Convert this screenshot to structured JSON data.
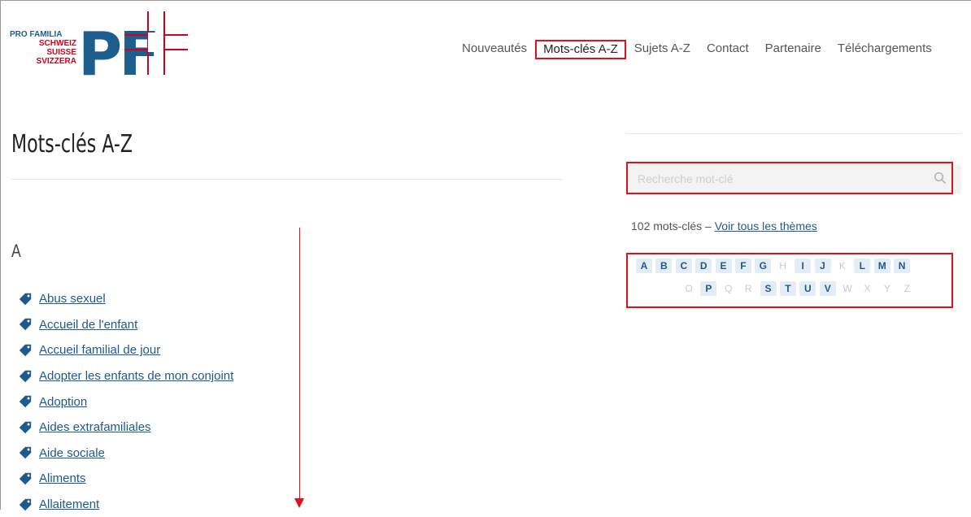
{
  "logo": {
    "line1": "PRO FAMILIA",
    "line2": "SCHWEIZ",
    "line3": "SUISSE",
    "line4": "SVIZZERA",
    "mark": "PF"
  },
  "nav": {
    "items": [
      {
        "label": "Nouveautés"
      },
      {
        "label": "Mots-clés A-Z"
      },
      {
        "label": "Sujets A-Z"
      },
      {
        "label": "Contact"
      },
      {
        "label": "Partenaire"
      },
      {
        "label": "Téléchargements"
      }
    ]
  },
  "main": {
    "title": "Mots-clés A-Z",
    "letter": "A",
    "keywords": [
      "Abus sexuel",
      "Accueil de l'enfant",
      "Accueil familial de jour",
      "Adopter les enfants de mon conjoint",
      "Adoption",
      "Aides extrafamiliales",
      "Aide sociale",
      "Aliments",
      "Allaitement"
    ]
  },
  "sidebar": {
    "search_placeholder": "Recherche mot-clé",
    "count_text": "102 mots-clés – ",
    "all_themes_link": "Voir tous les thèmes",
    "letters_row1": [
      {
        "l": "A",
        "active": true
      },
      {
        "l": "B",
        "active": true
      },
      {
        "l": "C",
        "active": true
      },
      {
        "l": "D",
        "active": true
      },
      {
        "l": "E",
        "active": true
      },
      {
        "l": "F",
        "active": true
      },
      {
        "l": "G",
        "active": true
      },
      {
        "l": "H",
        "active": false
      },
      {
        "l": "I",
        "active": true
      },
      {
        "l": "J",
        "active": true
      },
      {
        "l": "K",
        "active": false
      },
      {
        "l": "L",
        "active": true
      },
      {
        "l": "M",
        "active": true
      },
      {
        "l": "N",
        "active": true
      }
    ],
    "letters_row2": [
      {
        "l": "O",
        "active": false
      },
      {
        "l": "P",
        "active": true
      },
      {
        "l": "Q",
        "active": false
      },
      {
        "l": "R",
        "active": false
      },
      {
        "l": "S",
        "active": true
      },
      {
        "l": "T",
        "active": true
      },
      {
        "l": "U",
        "active": true
      },
      {
        "l": "V",
        "active": true
      },
      {
        "l": "W",
        "active": false
      },
      {
        "l": "X",
        "active": false
      },
      {
        "l": "Y",
        "active": false
      },
      {
        "l": "Z",
        "active": false
      }
    ]
  },
  "colors": {
    "link": "#1e5a8e",
    "highlight": "#e0111b",
    "brand_blue": "#1d5e8c",
    "brand_red": "#d0021b"
  }
}
